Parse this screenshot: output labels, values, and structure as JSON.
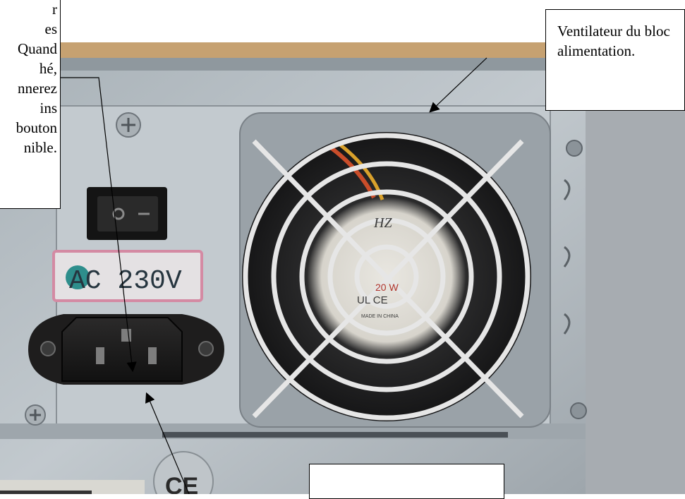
{
  "callouts": {
    "left_lines": [
      "r",
      "es",
      "Quand",
      "hé,",
      "nnerez",
      "ins",
      "bouton",
      "nible."
    ],
    "right_text": "Ventilateur du bloc alimentation.",
    "bottom_text": ""
  },
  "labels": {
    "voltage": "AC 230V",
    "fan_brand": "HZ",
    "fan_rating": "20 W",
    "fan_certs": "UL CE",
    "fan_made_in": "MADE IN CHINA",
    "ce_mark": "CE",
    "switch_on": "I",
    "switch_off": "O"
  },
  "colors": {
    "chassis": "#b9c0c6",
    "chassis_dark": "#8e969d",
    "socket": "#1c1b1b",
    "label_border": "#d48aa3",
    "label_text": "#26353f",
    "fan_blade": "#f2f0ea"
  }
}
